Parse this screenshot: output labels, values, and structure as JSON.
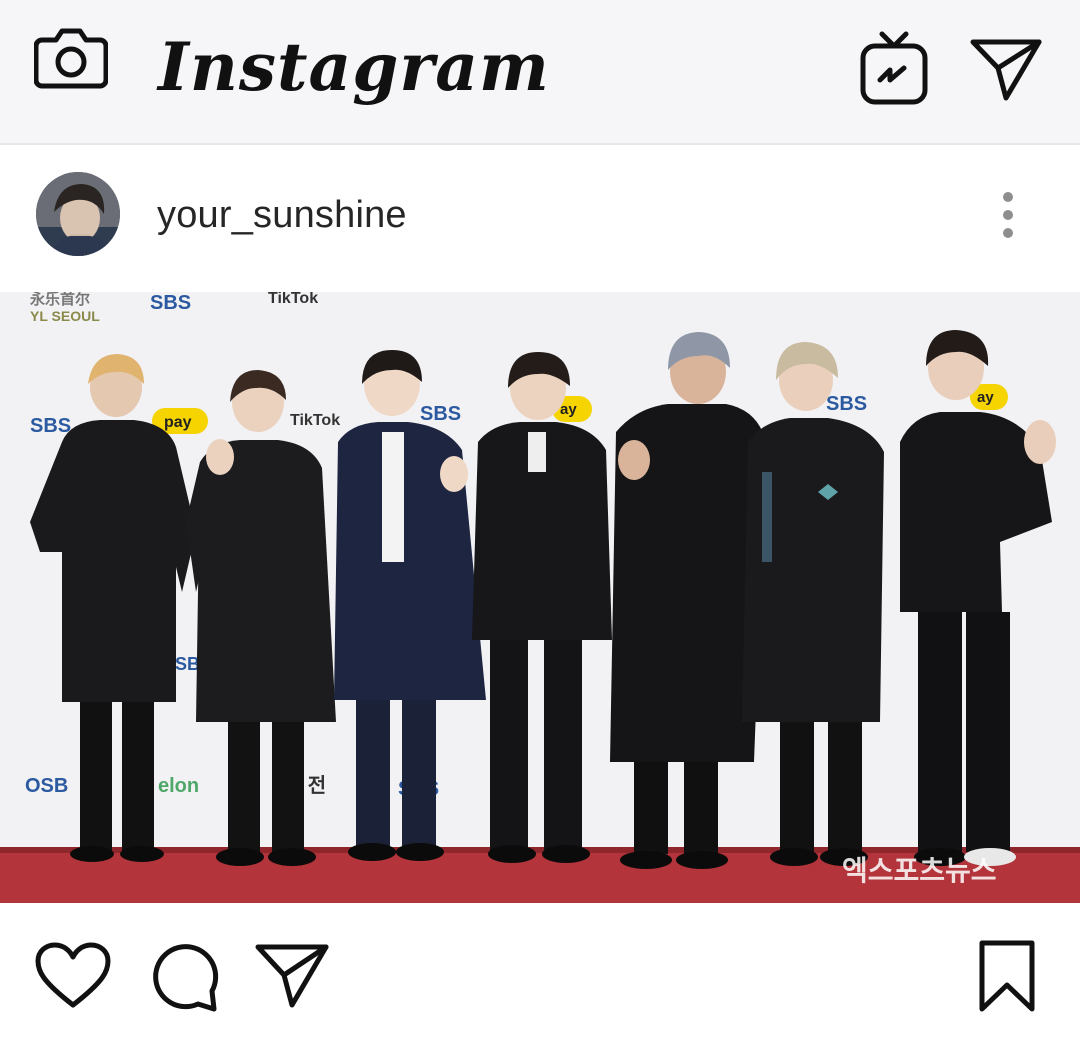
{
  "app": {
    "logo_text": "Instagram",
    "icons": {
      "camera": "camera-icon",
      "igtv": "igtv-icon",
      "direct": "direct-message-icon"
    }
  },
  "post": {
    "username": "your_sunshine",
    "more_icon": "more-options-icon",
    "photo": {
      "sponsor_logos": [
        "永乐首尔 YL SEOUL",
        "SBS",
        "TikTok",
        "pay",
        "elon",
        "17 전"
      ],
      "watermark": "엑스포츠뉴스"
    }
  },
  "actions": {
    "like_icon": "heart-icon",
    "comment_icon": "comment-icon",
    "share_icon": "share-icon",
    "save_icon": "bookmark-icon"
  },
  "colors": {
    "carpet": "#b3343a",
    "backdrop": "#f3f3f5",
    "icon": "#111111"
  }
}
